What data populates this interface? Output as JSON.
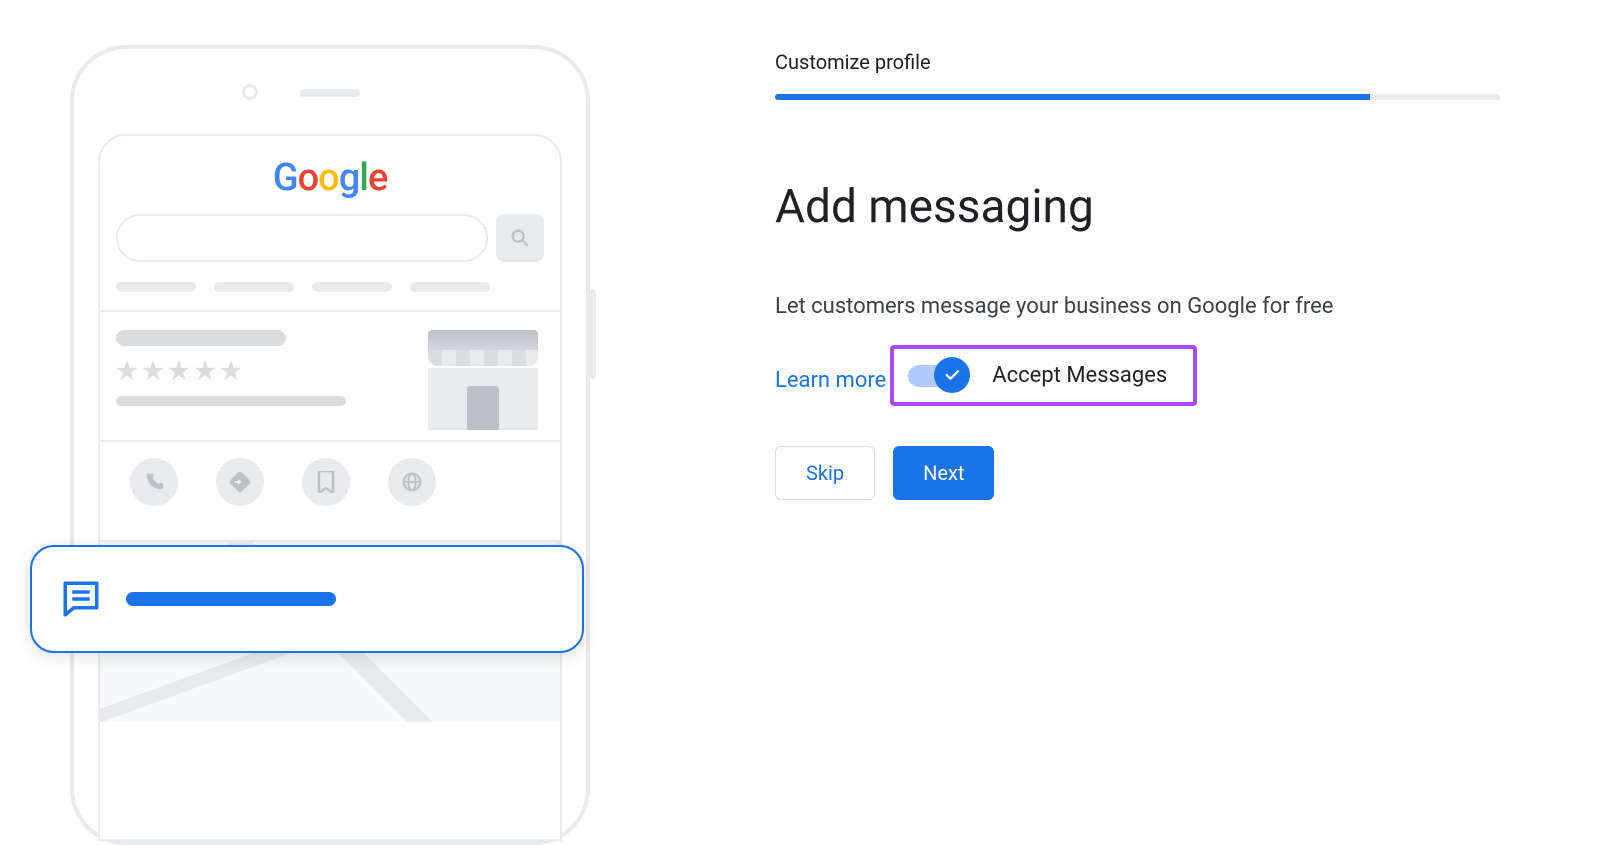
{
  "illustration": {
    "logo_letters": [
      "G",
      "o",
      "o",
      "g",
      "l",
      "e"
    ]
  },
  "step_label": "Customize profile",
  "progress_percent": 82,
  "heading": "Add messaging",
  "subtext": "Let customers message your business on Google for free",
  "learn_more": "Learn more",
  "toggle": {
    "label": "Accept Messages",
    "on": true
  },
  "buttons": {
    "skip": "Skip",
    "next": "Next"
  },
  "colors": {
    "primary": "#1a73e8",
    "highlight_border": "#a64dff"
  }
}
